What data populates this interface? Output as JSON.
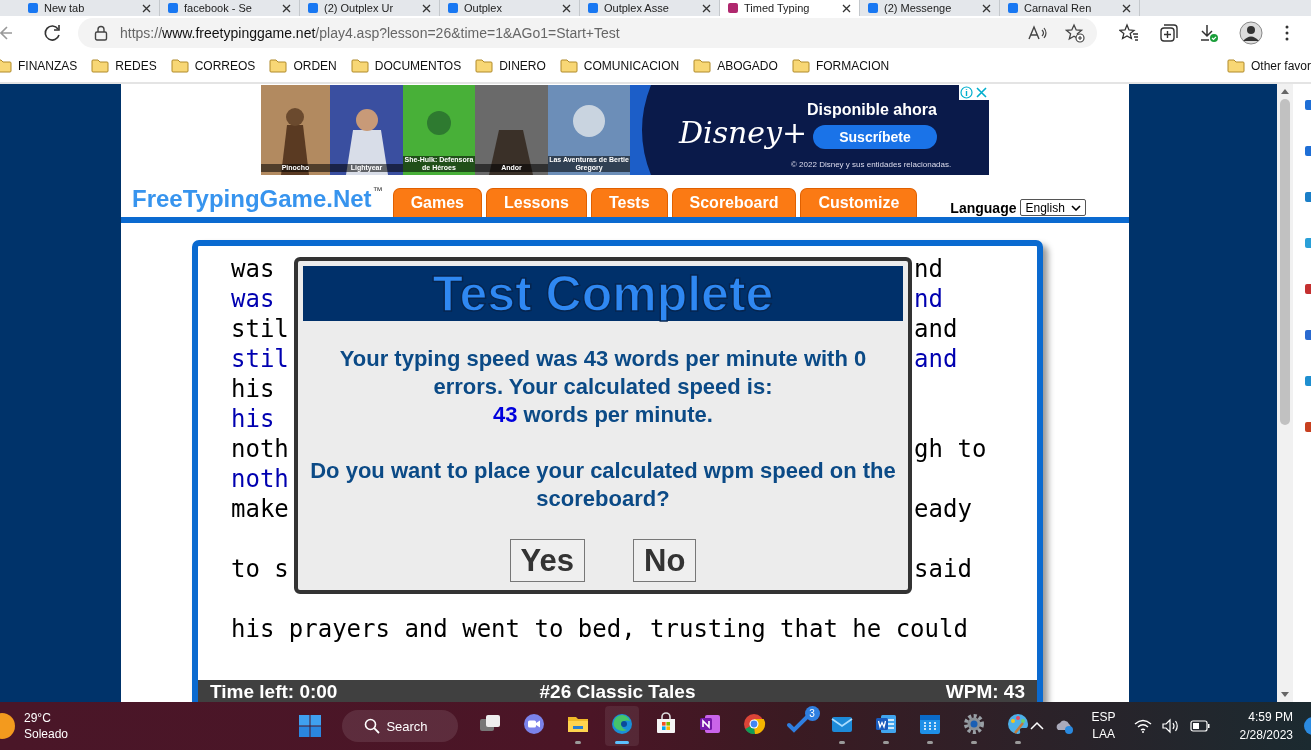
{
  "browser": {
    "tabs": [
      {
        "title": "New tab",
        "selected": false
      },
      {
        "title": "facebook - Se",
        "selected": false
      },
      {
        "title": "(2) Outplex Ur",
        "selected": false
      },
      {
        "title": "Outplex",
        "selected": false
      },
      {
        "title": "Outplex Asse",
        "selected": false
      },
      {
        "title": "Timed Typing",
        "selected": true
      },
      {
        "title": "(2) Messenge",
        "selected": false
      },
      {
        "title": "Carnaval Ren",
        "selected": false
      }
    ],
    "url_scheme": "https://",
    "url_host": "www.freetypinggame.net",
    "url_path": "/play4.asp?lesson=26&time=1&AGo1=Start+Test",
    "bookmarks": [
      "FINANZAS",
      "REDES",
      "CORREOS",
      "ORDEN",
      "DOCUMENTOS",
      "DINERO",
      "COMUNICACION",
      "ABOGADO",
      "FORMACION"
    ],
    "other_favorites": "Other favor"
  },
  "ad": {
    "captions": [
      "Pinocho",
      "Lightyear",
      "She-Hulk: Defensora de Héroes",
      "Andor",
      "Las Aventuras de Bertie Gregory"
    ],
    "brand": "Disney+",
    "headline": "Disponible ahora",
    "button": "Suscríbete",
    "legal": "© 2022 Disney y sus entidades relacionadas."
  },
  "site": {
    "logo": "FreeTypingGame.Net",
    "logo_mark": "™",
    "nav": [
      "Games",
      "Lessons",
      "Tests",
      "Scoreboard",
      "Customize"
    ],
    "language_label": "Language",
    "language": "English"
  },
  "typing": {
    "lines": [
      {
        "kind": "source",
        "left": "was",
        "right": "nd"
      },
      {
        "kind": "typed",
        "left": "was",
        "right": "nd"
      },
      {
        "kind": "source",
        "left": "stil",
        "right": "and"
      },
      {
        "kind": "typed",
        "left": "stil",
        "right": "and"
      },
      {
        "kind": "source",
        "left": "his"
      },
      {
        "kind": "typed",
        "left": "his"
      },
      {
        "kind": "source",
        "left": "noth",
        "right": "gh to"
      },
      {
        "kind": "typed",
        "left": "noth"
      },
      {
        "kind": "source",
        "left": "make",
        "right": "eady"
      },
      {
        "kind": "blank"
      },
      {
        "kind": "source",
        "left": "to s",
        "right": "said"
      },
      {
        "kind": "blank"
      },
      {
        "kind": "source",
        "left": "his prayers and went to bed, trusting that he could"
      }
    ],
    "status": {
      "time_left": "Time left: 0:00",
      "lesson": "#26 Classic Tales",
      "wpm": "WPM: 43"
    }
  },
  "dialog": {
    "title": "Test Complete",
    "message": "Your typing speed was 43 words per minute with 0 errors. Your calculated speed is:",
    "speed": "43",
    "speed_unit": "words per minute.",
    "question": "Do you want to place your calculated wpm speed on the scoreboard?",
    "buttons": [
      "Yes",
      "No"
    ]
  },
  "taskbar": {
    "weather": {
      "temperature": "29°C",
      "condition": "Soleado"
    },
    "search": "Search",
    "apps": [
      {
        "kind": "taskview",
        "running": false,
        "active": false
      },
      {
        "kind": "chat",
        "running": false,
        "active": false
      },
      {
        "kind": "explorer",
        "running": true,
        "active": false
      },
      {
        "kind": "edge",
        "running": true,
        "active": true
      },
      {
        "kind": "store",
        "running": false,
        "active": false
      },
      {
        "kind": "onenote",
        "running": false,
        "active": false
      },
      {
        "kind": "chrome",
        "running": false,
        "active": false
      },
      {
        "kind": "todo",
        "running": false,
        "active": false,
        "badge": "3"
      },
      {
        "kind": "mail",
        "running": true,
        "active": false
      },
      {
        "kind": "word",
        "running": true,
        "active": false
      },
      {
        "kind": "calendar",
        "running": true,
        "active": false
      },
      {
        "kind": "settings",
        "running": true,
        "active": false
      },
      {
        "kind": "paint",
        "running": true,
        "active": false
      }
    ],
    "language": "ESP",
    "layout": "LAA",
    "time": "4:59 PM",
    "date": "2/28/2023"
  }
}
